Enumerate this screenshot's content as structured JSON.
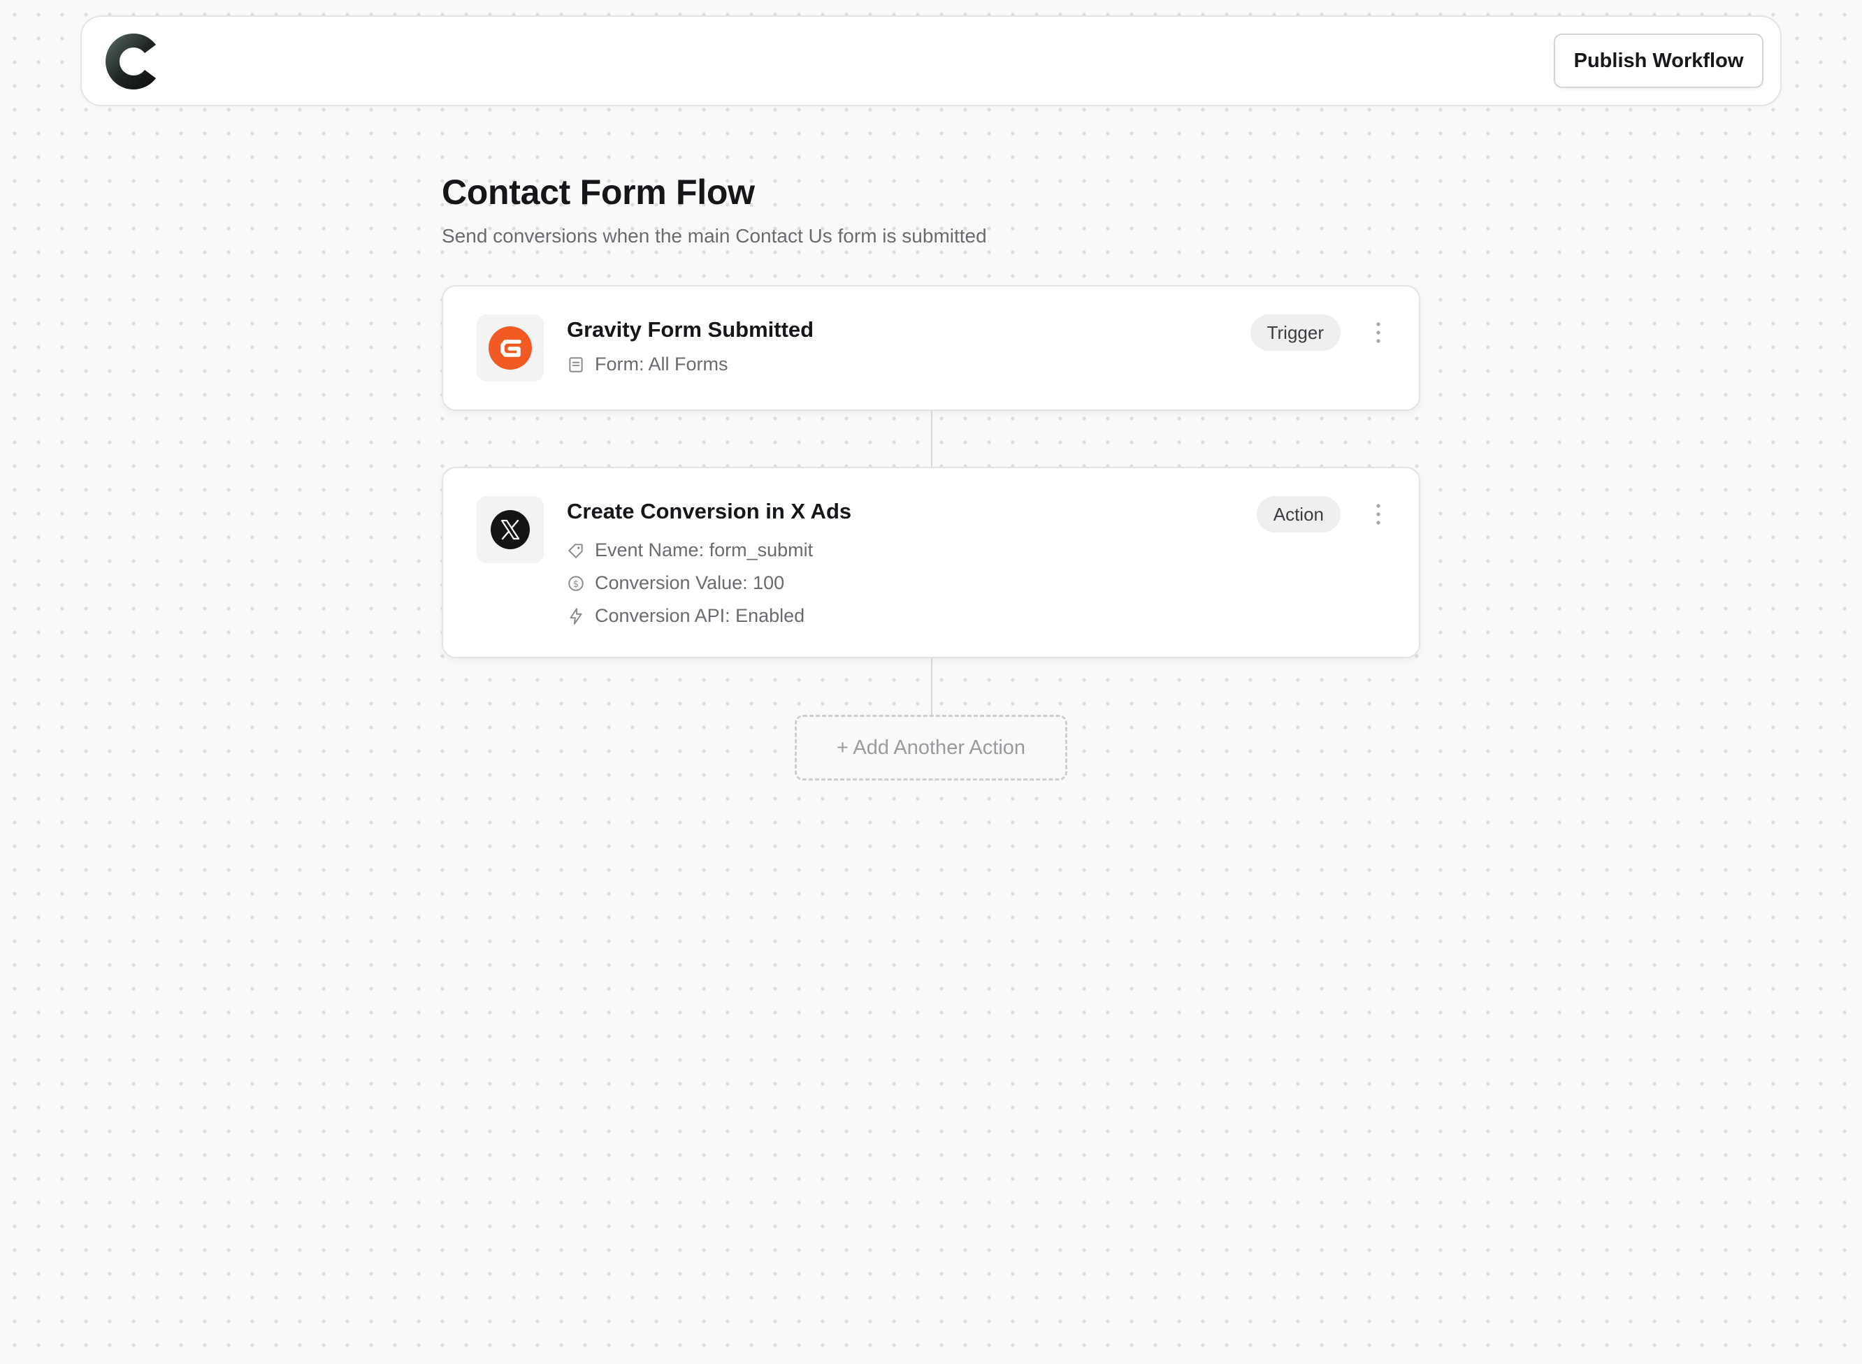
{
  "header": {
    "publish_label": "Publish Workflow"
  },
  "workflow": {
    "title": "Contact Form Flow",
    "subtitle": "Send conversions when the main Contact Us form is submitted"
  },
  "trigger_card": {
    "icon": "gravity-forms-logo",
    "title": "Gravity Form Submitted",
    "badge": "Trigger",
    "details": [
      {
        "icon": "form-icon",
        "text": "Form: All Forms"
      }
    ]
  },
  "action_card": {
    "icon": "x-logo",
    "title": "Create Conversion in X Ads",
    "badge": "Action",
    "details": [
      {
        "icon": "tag-icon",
        "text": "Event Name: form_submit"
      },
      {
        "icon": "dollar-circle-icon",
        "text": "Conversion Value: 100"
      },
      {
        "icon": "lightning-icon",
        "text": "Conversion API: Enabled"
      }
    ]
  },
  "add_action_label": "+ Add Another Action",
  "colors": {
    "gravity_orange": "#f15a22",
    "x_black": "#141414",
    "canvas_bg": "#f9f9f9"
  }
}
